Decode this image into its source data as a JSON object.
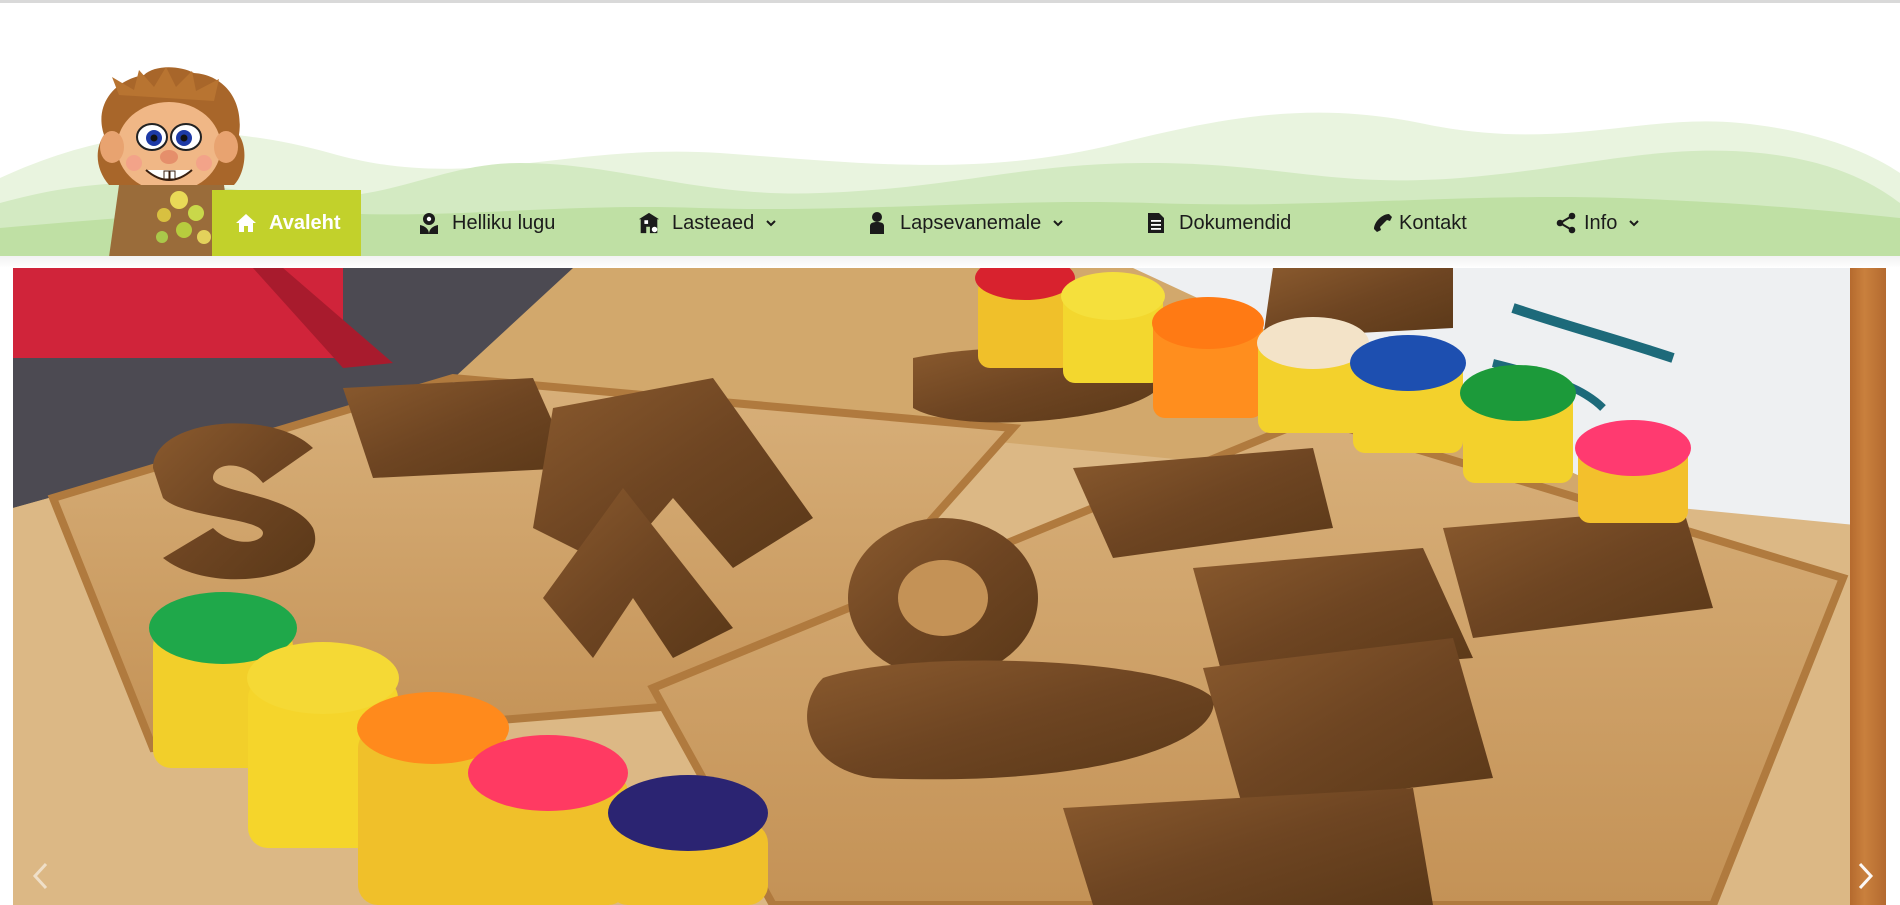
{
  "site": {
    "logo_alt": "Helliku troll logo"
  },
  "nav": {
    "items": [
      {
        "label": "Avaleht",
        "icon": "home-icon",
        "dropdown": false,
        "active": true
      },
      {
        "label": "Helliku lugu",
        "icon": "flower-badge-icon",
        "dropdown": false,
        "active": false
      },
      {
        "label": "Lasteaed",
        "icon": "school-building-icon",
        "dropdown": true,
        "active": false
      },
      {
        "label": "Lapsevanemale",
        "icon": "person-icon",
        "dropdown": true,
        "active": false
      },
      {
        "label": "Dokumendid",
        "icon": "document-icon",
        "dropdown": false,
        "active": false
      },
      {
        "label": "Kontakt",
        "icon": "phone-icon",
        "dropdown": false,
        "active": false
      },
      {
        "label": "Info",
        "icon": "share-icon",
        "dropdown": true,
        "active": false
      }
    ]
  },
  "slider": {
    "prev_icon": "chevron-left-icon",
    "next_icon": "chevron-right-icon",
    "current_slide": "wooden letters and play-dough tubs"
  },
  "colors": {
    "accent": "#c2d12b",
    "hill_light": "#e9f4df",
    "hill_mid": "#d3eac2",
    "hill_dark": "#bfe0a4"
  }
}
